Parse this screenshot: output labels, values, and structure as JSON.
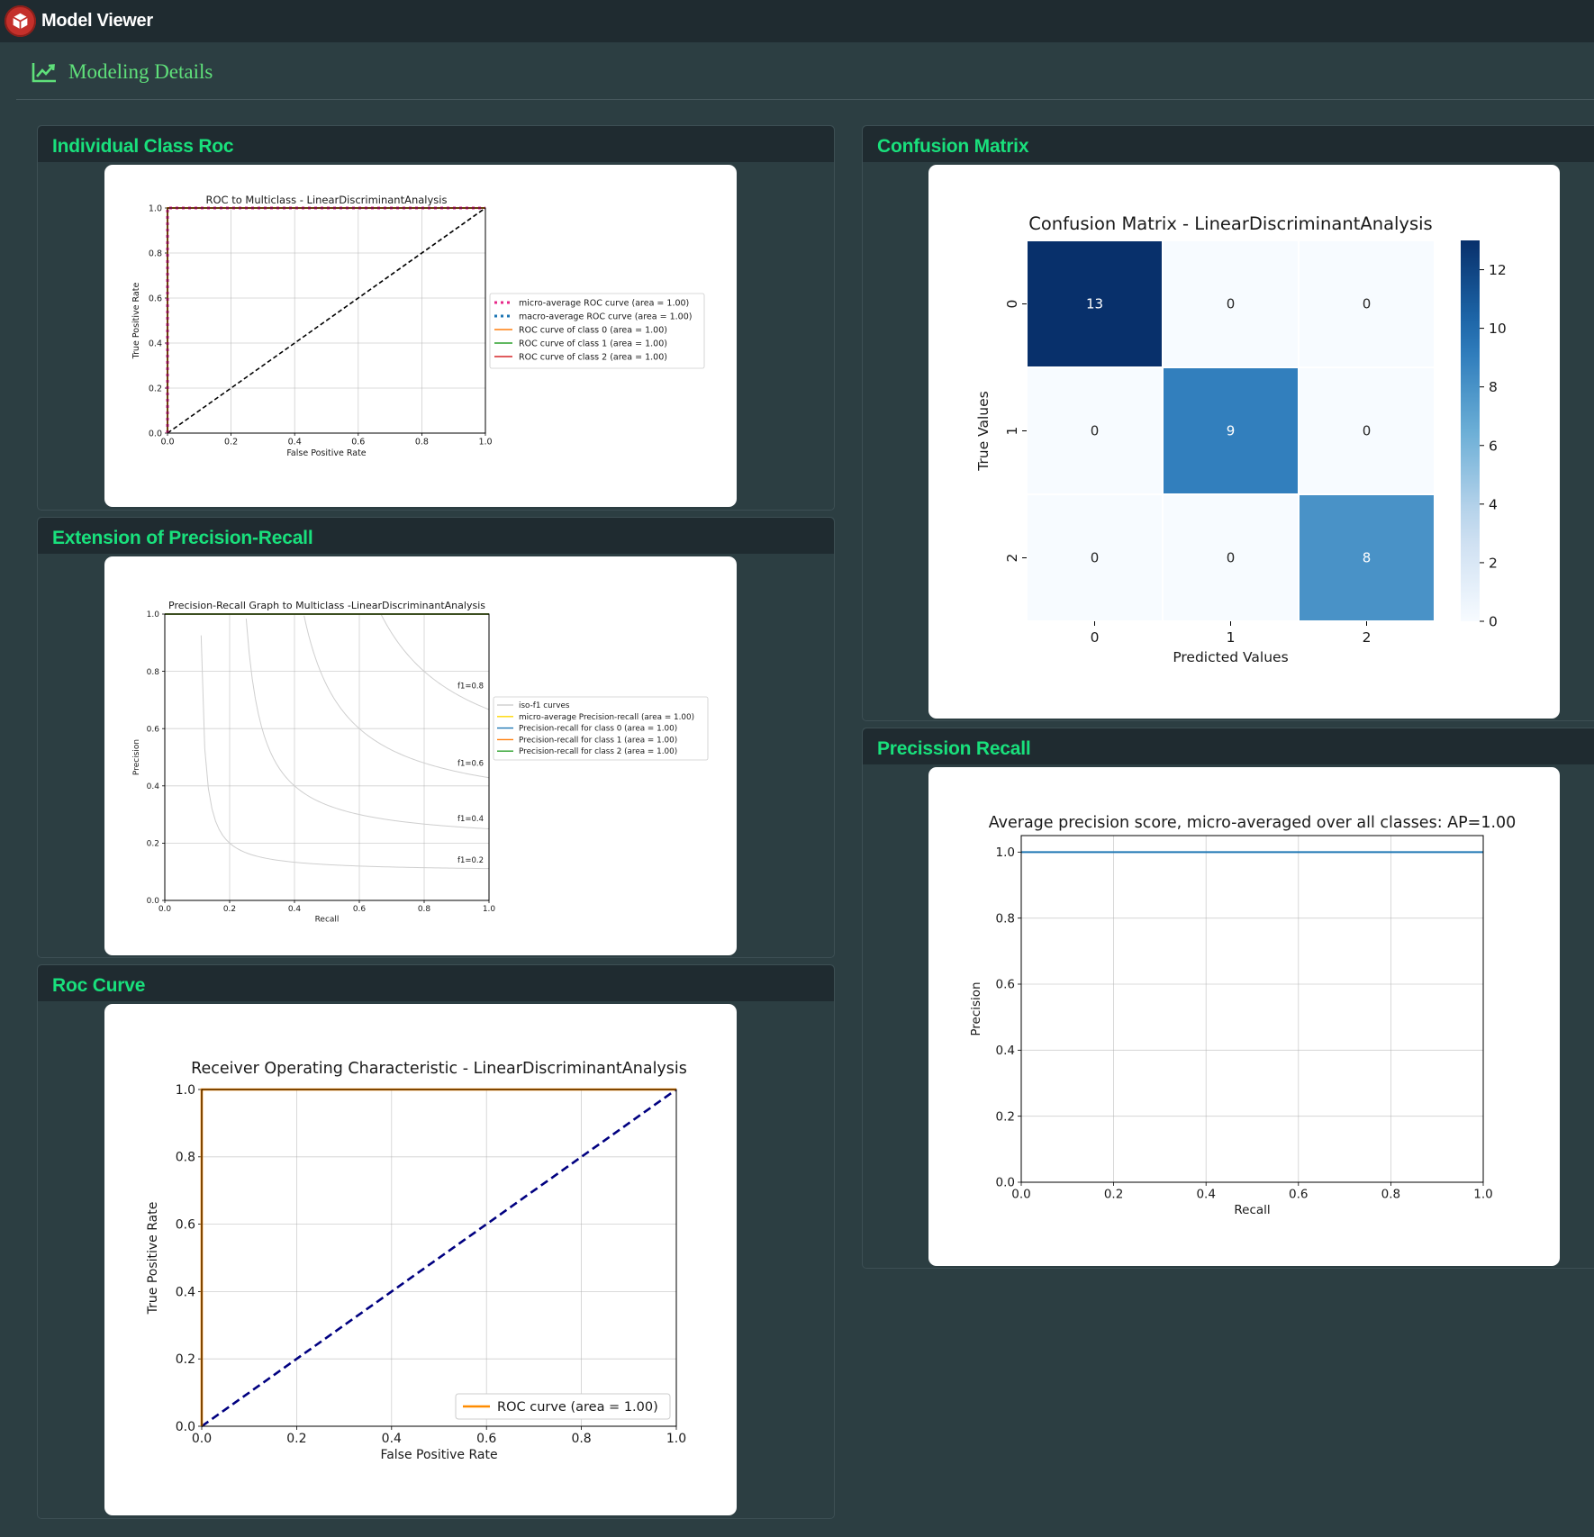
{
  "app": {
    "title": "Model Viewer",
    "logo_icon": "cube-icon"
  },
  "page": {
    "title": "Modeling Details",
    "title_icon": "line-chart-icon"
  },
  "colors": {
    "accent": "#19e07c",
    "page_title": "#5fe07a",
    "bg": "#2c3e42",
    "header_bg": "#1f2b30"
  },
  "panels": {
    "individual_roc": "Individual Class Roc",
    "pr_extension": "Extension of Precision-Recall",
    "roc_curve": "Roc Curve",
    "confusion": "Confusion Matrix",
    "precision_recall": "Precission Recall"
  },
  "chart_data": [
    {
      "id": "individual_roc",
      "type": "line",
      "title": "ROC to Multiclass - LinearDiscriminantAnalysis",
      "xlabel": "False Positive Rate",
      "ylabel": "True Positive Rate",
      "xlim": [
        0,
        1
      ],
      "ylim": [
        0,
        1
      ],
      "ticks": [
        "0.0",
        "0.2",
        "0.4",
        "0.6",
        "0.8",
        "1.0"
      ],
      "grid": true,
      "legend_position": "right",
      "series": [
        {
          "name": "micro-average ROC curve (area = 1.00)",
          "color": "#e7298a",
          "style": "dotted",
          "x": [
            0,
            0,
            1
          ],
          "y": [
            0,
            1,
            1
          ]
        },
        {
          "name": "macro-average ROC curve (area = 1.00)",
          "color": "#1f77b4",
          "style": "dotted",
          "x": [
            0,
            0,
            1
          ],
          "y": [
            0,
            1,
            1
          ]
        },
        {
          "name": "ROC curve of class 0 (area = 1.00)",
          "color": "#ff7f0e",
          "style": "solid",
          "x": [
            0,
            0,
            1
          ],
          "y": [
            0,
            1,
            1
          ]
        },
        {
          "name": "ROC curve of class 1 (area = 1.00)",
          "color": "#2ca02c",
          "style": "solid",
          "x": [
            0,
            0,
            1
          ],
          "y": [
            0,
            1,
            1
          ]
        },
        {
          "name": "ROC curve of class 2 (area = 1.00)",
          "color": "#d62728",
          "style": "solid",
          "x": [
            0,
            0,
            1
          ],
          "y": [
            0,
            1,
            1
          ]
        }
      ],
      "chance_line": {
        "x": [
          0,
          1
        ],
        "y": [
          0,
          1
        ],
        "color": "#000000"
      }
    },
    {
      "id": "pr_extension",
      "type": "line",
      "title": "Precision-Recall Graph to Multiclass -LinearDiscriminantAnalysis",
      "xlabel": "Recall",
      "ylabel": "Precision",
      "xlim": [
        0,
        1
      ],
      "ylim": [
        0,
        1
      ],
      "ticks": [
        "0.0",
        "0.2",
        "0.4",
        "0.6",
        "0.8",
        "1.0"
      ],
      "grid": true,
      "legend_position": "right",
      "iso_f1": [
        0.2,
        0.4,
        0.6,
        0.8
      ],
      "iso_f1_labels": [
        "f1=0.2",
        "f1=0.4",
        "f1=0.6",
        "f1=0.8"
      ],
      "series": [
        {
          "name": "iso-f1 curves",
          "color": "#d0d0d0"
        },
        {
          "name": "micro-average Precision-recall (area = 1.00)",
          "color": "#ffd700",
          "x": [
            0,
            1
          ],
          "y": [
            1,
            1
          ]
        },
        {
          "name": "Precision-recall for class 0 (area = 1.00)",
          "color": "#1f77b4",
          "x": [
            0,
            1
          ],
          "y": [
            1,
            1
          ]
        },
        {
          "name": "Precision-recall for class 1 (area = 1.00)",
          "color": "#ff7f0e",
          "x": [
            0,
            1
          ],
          "y": [
            1,
            1
          ]
        },
        {
          "name": "Precision-recall for class 2 (area = 1.00)",
          "color": "#2ca02c",
          "x": [
            0,
            1
          ],
          "y": [
            1,
            1
          ]
        }
      ]
    },
    {
      "id": "roc_curve",
      "type": "line",
      "title": "Receiver Operating Characteristic - LinearDiscriminantAnalysis",
      "xlabel": "False Positive Rate",
      "ylabel": "True Positive Rate",
      "xlim": [
        0,
        1
      ],
      "ylim": [
        0,
        1
      ],
      "ticks": [
        "0.0",
        "0.2",
        "0.4",
        "0.6",
        "0.8",
        "1.0"
      ],
      "grid": true,
      "legend_position": "lower right",
      "series": [
        {
          "name": "ROC curve (area = 1.00)",
          "color": "#ff8c00",
          "x": [
            0,
            0,
            1
          ],
          "y": [
            0,
            1,
            1
          ]
        }
      ],
      "chance_line": {
        "x": [
          0,
          1
        ],
        "y": [
          0,
          1
        ],
        "color": "#000080"
      }
    },
    {
      "id": "confusion",
      "type": "heatmap",
      "title": "Confusion Matrix - LinearDiscriminantAnalysis",
      "xlabel": "Predicted Values",
      "ylabel": "True Values",
      "x_categories": [
        "0",
        "1",
        "2"
      ],
      "y_categories": [
        "0",
        "1",
        "2"
      ],
      "values": [
        [
          13,
          0,
          0
        ],
        [
          0,
          9,
          0
        ],
        [
          0,
          0,
          8
        ]
      ],
      "colorscale": "Blues",
      "colorbar_ticks": [
        "0",
        "2",
        "4",
        "6",
        "8",
        "10",
        "12"
      ],
      "colorbar_range": [
        0,
        13
      ]
    },
    {
      "id": "precision_recall",
      "type": "line",
      "title": "Average precision score, micro-averaged over all classes: AP=1.00",
      "xlabel": "Recall",
      "ylabel": "Precision",
      "xlim": [
        0,
        1
      ],
      "ylim": [
        0,
        1.05
      ],
      "xticks": [
        "0.0",
        "0.2",
        "0.4",
        "0.6",
        "0.8",
        "1.0"
      ],
      "yticks": [
        "0.0",
        "0.2",
        "0.4",
        "0.6",
        "0.8",
        "1.0"
      ],
      "grid": true,
      "series": [
        {
          "color": "#1f77b4",
          "x": [
            0,
            1
          ],
          "y": [
            1,
            1
          ]
        }
      ]
    }
  ]
}
